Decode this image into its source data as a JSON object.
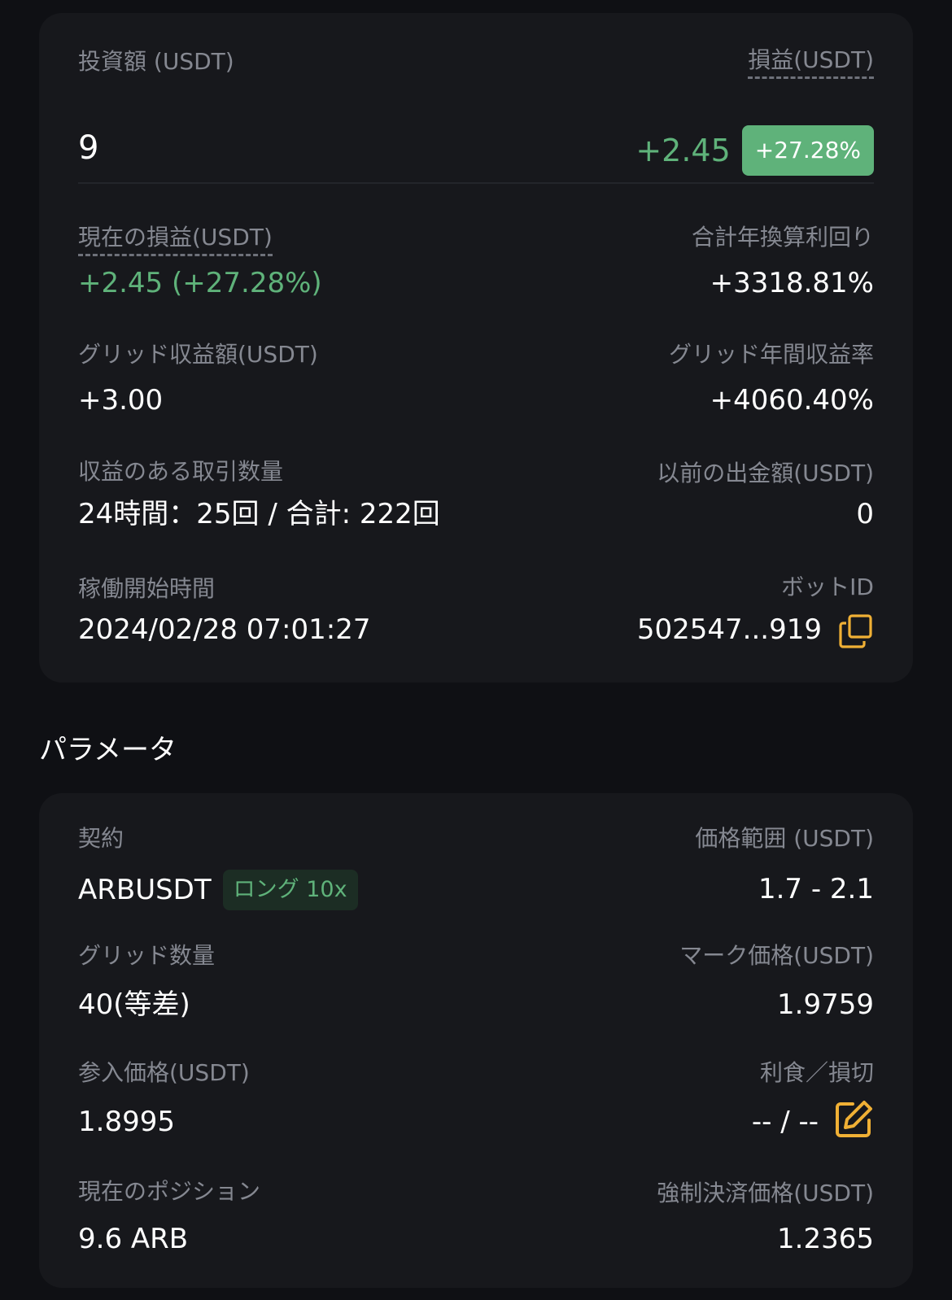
{
  "summary": {
    "investment_label": "投資額 (USDT)",
    "investment_value": "9",
    "pnl_label": "損益(USDT)",
    "pnl_value": "+2.45",
    "pnl_percent": "+27.28%",
    "current_pnl_label": "現在の損益(USDT)",
    "current_pnl_value": "+2.45 (+27.28%)",
    "total_apr_label": "合計年換算利回り",
    "total_apr_value": "+3318.81%",
    "grid_profit_label": "グリッド収益額(USDT)",
    "grid_profit_value": "+3.00",
    "grid_apr_label": "グリッド年間収益率",
    "grid_apr_value": "+4060.40%",
    "profitable_trades_label": "収益のある取引数量",
    "profitable_trades_value": "24時間：25回 / 合計: 222回",
    "withdrawn_label": "以前の出金額(USDT)",
    "withdrawn_value": "0",
    "start_time_label": "稼働開始時間",
    "start_time_value": "2024/02/28 07:01:27",
    "bot_id_label": "ボットID",
    "bot_id_value": "502547...919",
    "copy_icon": "copy-icon"
  },
  "parameters": {
    "section_title": "パラメータ",
    "contract_label": "契約",
    "contract_value": "ARBUSDT",
    "contract_tag": "ロング 10x",
    "price_range_label": "価格範囲 (USDT)",
    "price_range_value": "1.7 - 2.1",
    "grid_count_label": "グリッド数量",
    "grid_count_value": "40(等差)",
    "mark_price_label": "マーク価格(USDT)",
    "mark_price_value": "1.9759",
    "entry_price_label": "参入価格(USDT)",
    "entry_price_value": "1.8995",
    "tpsl_label": "利食／損切",
    "tpsl_value": "-- / --",
    "edit_icon": "edit-icon",
    "position_label": "現在のポジション",
    "position_value": "9.6 ARB",
    "liq_price_label": "強制決済価格(USDT)",
    "liq_price_value": "1.2365"
  },
  "colors": {
    "background": "#0f1014",
    "card": "#17181c",
    "positive": "#5fb27a",
    "accent": "#f0b035",
    "muted": "#858891"
  }
}
